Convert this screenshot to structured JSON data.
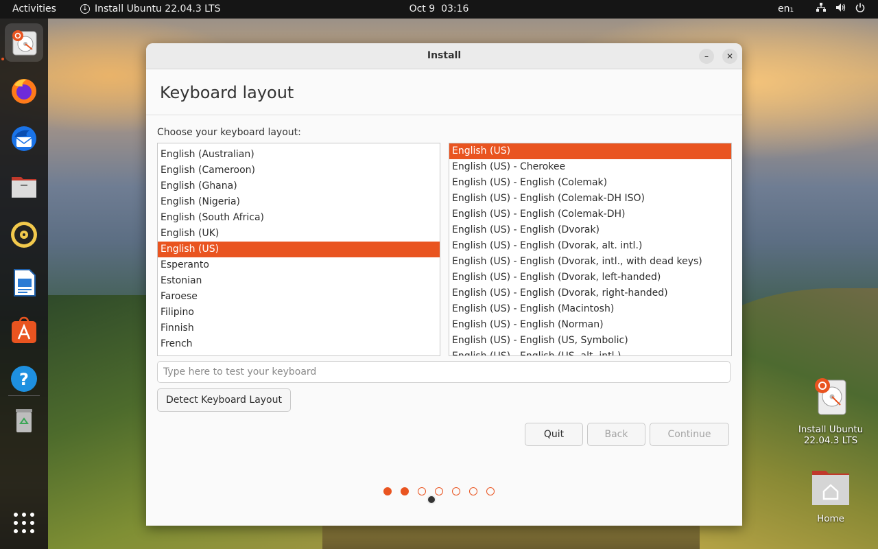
{
  "topbar": {
    "activities": "Activities",
    "app_name": "Install Ubuntu 22.04.3 LTS",
    "date": "Oct 9",
    "time": "03:16",
    "language": "en₁"
  },
  "dock": {
    "items": [
      "ubuntu-installer-icon",
      "firefox-icon",
      "thunderbird-icon",
      "files-icon",
      "rhythmbox-icon",
      "libreoffice-writer-icon",
      "app-center-icon",
      "help-icon",
      "trash-icon",
      "show-apps-icon"
    ]
  },
  "desktop": {
    "installer_label": "Install Ubuntu 22.04.3 LTS",
    "home_label": "Home"
  },
  "window": {
    "title": "Install",
    "heading": "Keyboard layout",
    "prompt": "Choose your keyboard layout:",
    "layouts": [
      "English (Australian)",
      "English (Cameroon)",
      "English (Ghana)",
      "English (Nigeria)",
      "English (South Africa)",
      "English (UK)",
      "English (US)",
      "Esperanto",
      "Estonian",
      "Faroese",
      "Filipino",
      "Finnish",
      "French"
    ],
    "selected_layout": "English (US)",
    "variants": [
      "English (US)",
      "English (US) - Cherokee",
      "English (US) - English (Colemak)",
      "English (US) - English (Colemak-DH ISO)",
      "English (US) - English (Colemak-DH)",
      "English (US) - English (Dvorak)",
      "English (US) - English (Dvorak, alt. intl.)",
      "English (US) - English (Dvorak, intl., with dead keys)",
      "English (US) - English (Dvorak, left-handed)",
      "English (US) - English (Dvorak, right-handed)",
      "English (US) - English (Macintosh)",
      "English (US) - English (Norman)",
      "English (US) - English (US, Symbolic)",
      "English (US) - English (US, alt. intl.)"
    ],
    "selected_variant": "English (US)",
    "test_placeholder": "Type here to test your keyboard",
    "test_value": "",
    "detect_label": "Detect Keyboard Layout",
    "quit_label": "Quit",
    "back_label": "Back",
    "continue_label": "Continue",
    "progress": {
      "total_steps": 7,
      "current_step": 2
    }
  },
  "colors": {
    "accent": "#e95420",
    "topbar": "#151515",
    "window_bg": "#fafafa"
  }
}
